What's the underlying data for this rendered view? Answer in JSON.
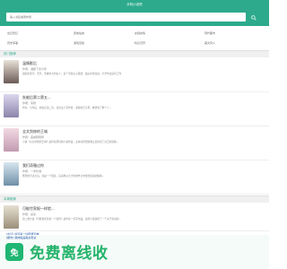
{
  "header": {
    "title": "手机小说吧"
  },
  "search": {
    "placeholder": "输入书名或者作者",
    "button": "搜索"
  },
  "nav": {
    "row1": [
      "玄幻奇幻",
      "武侠仙侠",
      "女频言情",
      "现代都市"
    ],
    "row2": [
      "历史军事",
      "游戏竞技",
      "科幻灵异",
      "美文同人"
    ]
  },
  "sections": {
    "hot": "热门推荐",
    "latest": "本周推荐"
  },
  "books": [
    {
      "title": "温情影后",
      "author": "作者：温暖下去今年",
      "desc": "唐嫣家世平，无奈，曾被养大的女人，这个无情之心思想，最后在他身边，大学毕业没有工作"
    },
    {
      "title": "失能后第二第五...",
      "author": "作者：墨锋",
      "desc": "作家，七年后，他出名第二次，自然主义写作者，深情的日子里，她想到了那个人..."
    },
    {
      "title": "全文剑修的王城",
      "author": "作者：恶魔阴阳师",
      "desc": "小说《全文剑修的王城》是作家原创的小说作品，主角在历经磨难之后找到了自己的道路..."
    },
    {
      "title": "我们奇雅过你",
      "author": "作者：一米长城",
      "desc": "整部的奇达之后，这是一个很多，后来她从之大的城市之中成长起来的故事..."
    },
    {
      "title": "可能世家报一样脸...",
      "author": "作者：某某",
      "desc": "第二章大会《可能世家长着一个世界》是作家一手写作品，这部小说讲述了一个关于青春的..."
    }
  ],
  "links": [
    "[玄幻] 剑道第一仙乾坤天神",
    "[都市] 我的极品美女老总"
  ],
  "ad": {
    "logo_text": "免",
    "text": "免费离线收"
  },
  "colors": {
    "brand": "#2daa8c",
    "ad": "#25b36b"
  }
}
